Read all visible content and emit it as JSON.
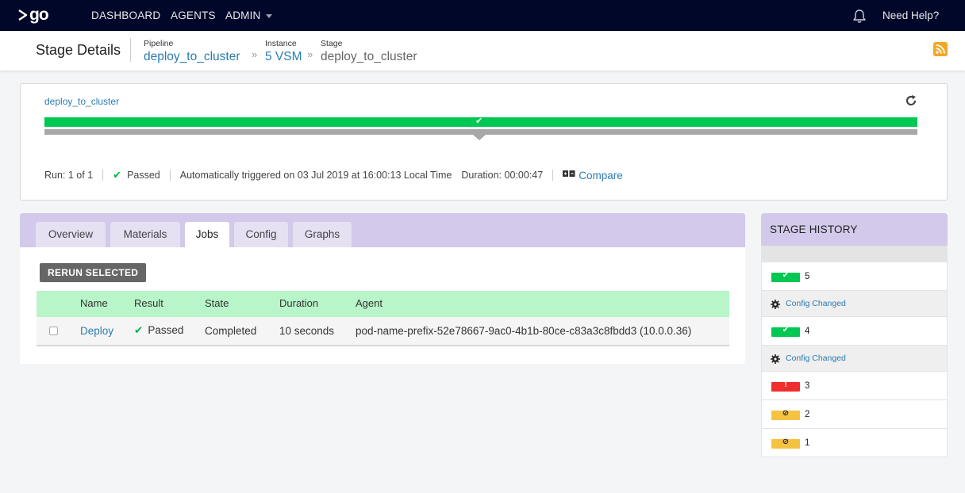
{
  "nav": {
    "logo_text": "go",
    "items": [
      "DASHBOARD",
      "AGENTS",
      "ADMIN"
    ],
    "help": "Need Help?"
  },
  "header": {
    "title": "Stage Details",
    "pipeline_key": "Pipeline",
    "pipeline_value": "deploy_to_cluster",
    "instance_key": "Instance",
    "instance_value": "5 VSM",
    "stage_key": "Stage",
    "stage_value": "deploy_to_cluster"
  },
  "stage": {
    "name_link": "deploy_to_cluster",
    "run": "Run: 1 of 1",
    "status": "Passed",
    "trigger": "Automatically triggered on 03 Jul 2019 at 16:00:13 Local Time",
    "duration": "Duration: 00:00:47",
    "compare": "Compare",
    "progress_fraction": 1.0
  },
  "tabs": [
    "Overview",
    "Materials",
    "Jobs",
    "Config",
    "Graphs"
  ],
  "active_tab": "Jobs",
  "jobs": {
    "rerun_label": "RERUN SELECTED",
    "columns": [
      "Name",
      "Result",
      "State",
      "Duration",
      "Agent"
    ],
    "rows": [
      {
        "name": "Deploy",
        "result": "Passed",
        "state": "Completed",
        "duration": "10 seconds",
        "agent": "pod-name-prefix-52e78667-9ac0-4b1b-80ce-c83a3c8fbdd3 (10.0.0.36)"
      }
    ]
  },
  "history": {
    "title": "STAGE HISTORY",
    "config_changed": "Config Changed",
    "entries": [
      {
        "kind": "run",
        "status": "passed",
        "counter": "5"
      },
      {
        "kind": "config"
      },
      {
        "kind": "run",
        "status": "passed",
        "counter": "4"
      },
      {
        "kind": "config"
      },
      {
        "kind": "run",
        "status": "failed",
        "counter": "3"
      },
      {
        "kind": "run",
        "status": "cancelled",
        "counter": "2"
      },
      {
        "kind": "run",
        "status": "cancelled",
        "counter": "1"
      }
    ]
  },
  "colors": {
    "nav_bg": "#000728",
    "passed": "#00c853",
    "failed": "#ef2e2e",
    "cancelled": "#f5c340",
    "link": "#2a7cb2",
    "tab_bar": "#d3c9ea",
    "table_header": "#b8f5c9"
  }
}
